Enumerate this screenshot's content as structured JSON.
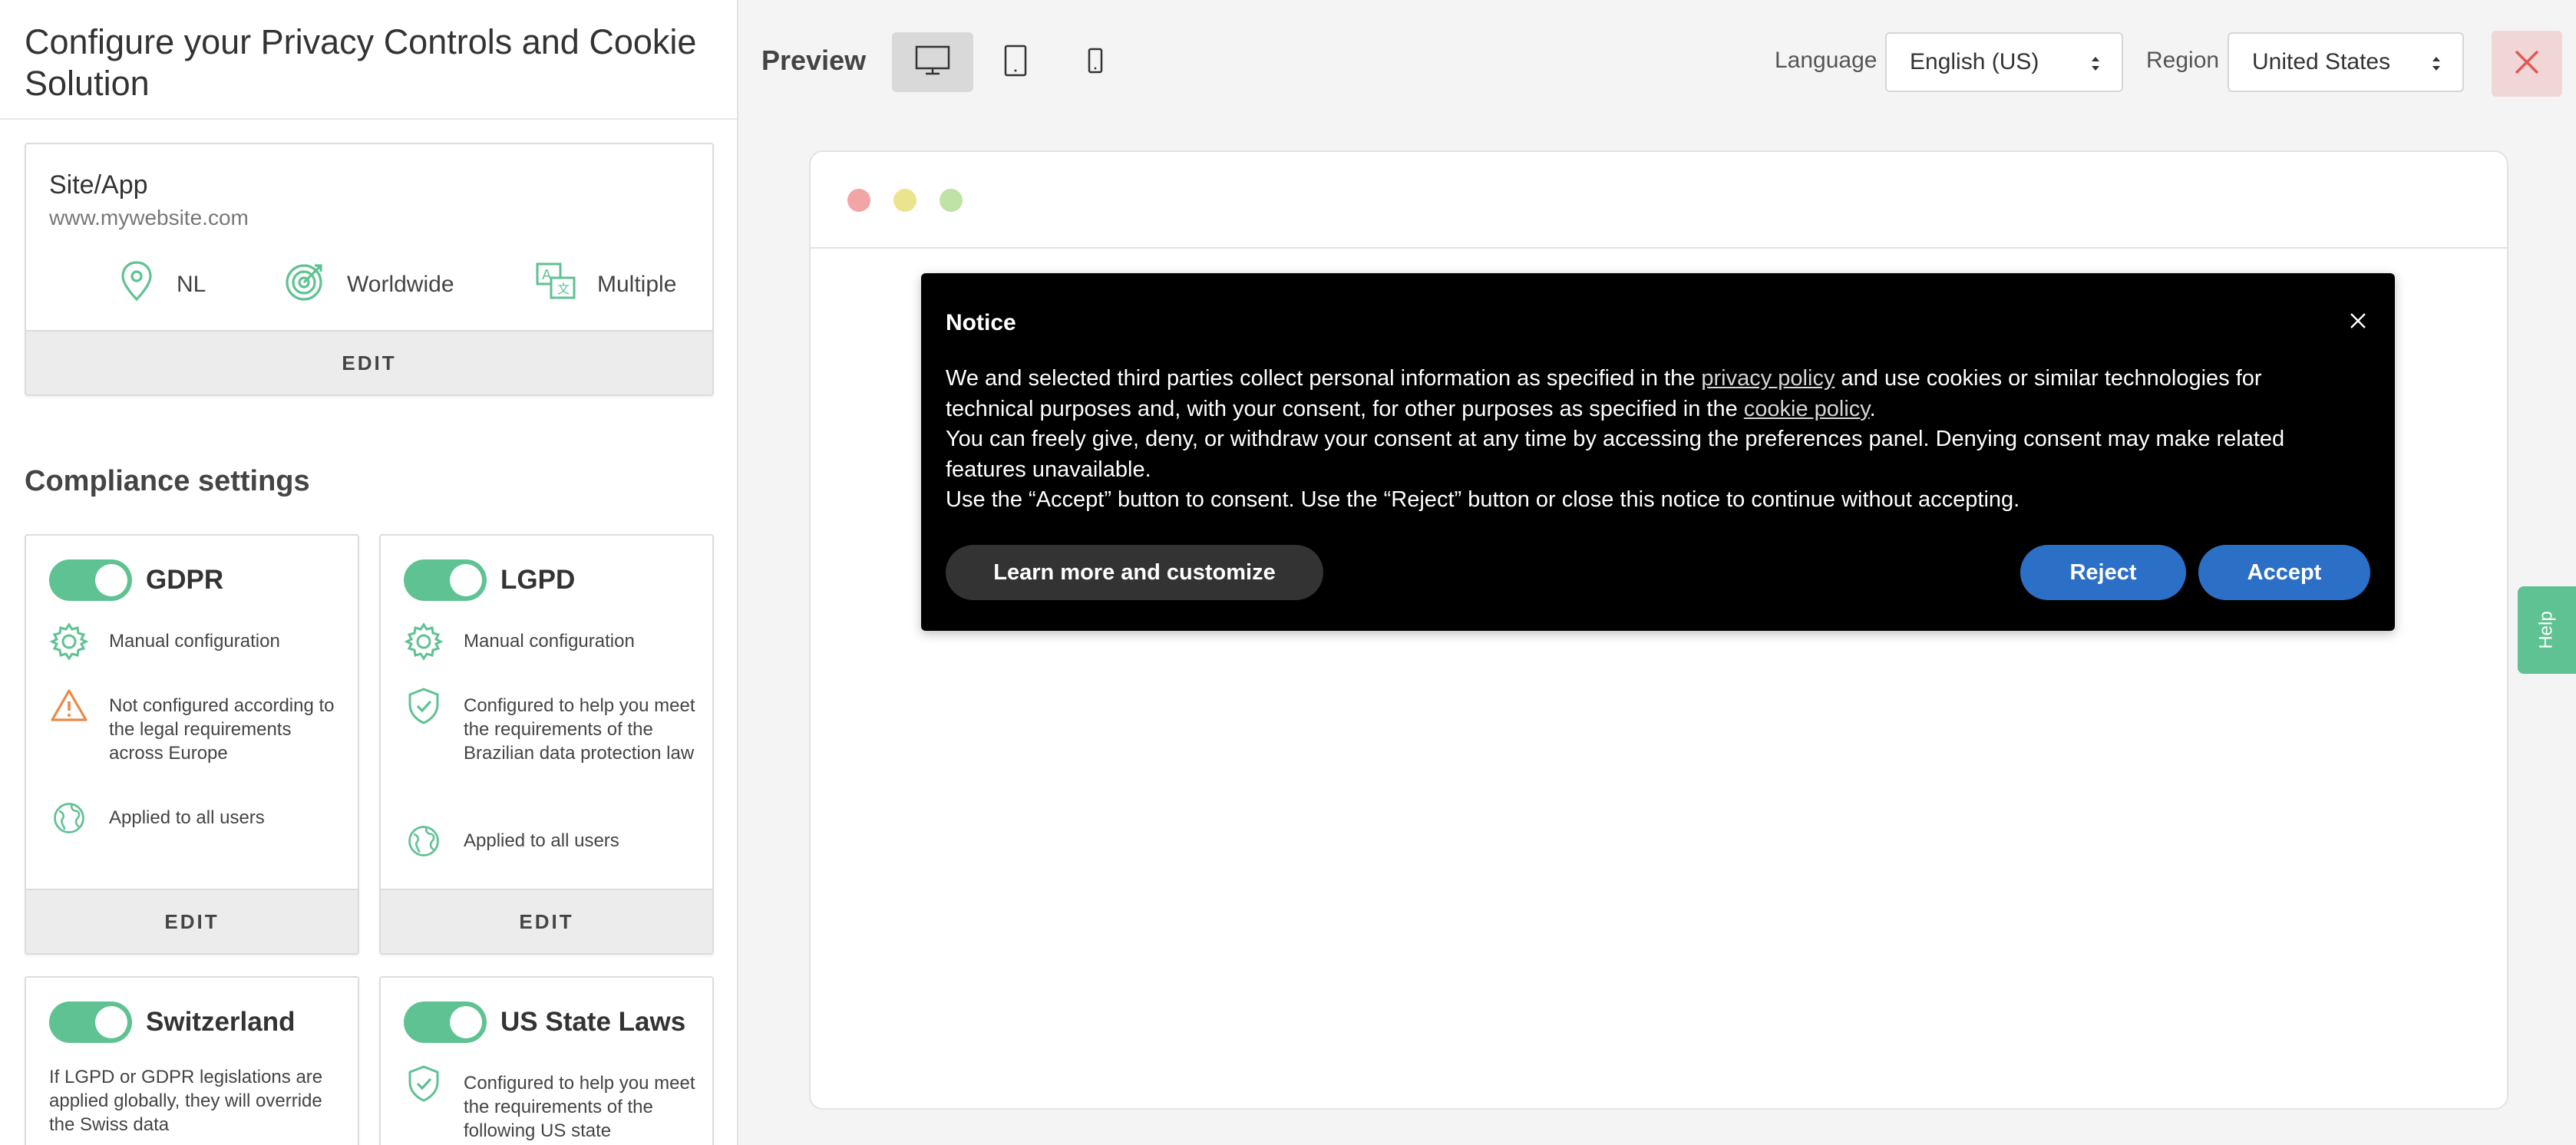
{
  "left_panel": {
    "title": "Configure your Privacy Controls and Cookie Solution",
    "site": {
      "name": "Site/App",
      "url": "www.mywebsite.com",
      "location": "NL",
      "scope": "Worldwide",
      "languages": "Multiple",
      "edit_label": "EDIT"
    },
    "compliance_title": "Compliance settings",
    "regulations": [
      {
        "name": "GDPR",
        "rows": [
          "Manual configuration",
          "Not configured according to the legal requirements across Europe",
          "Applied to all users"
        ],
        "edit_label": "EDIT"
      },
      {
        "name": "LGPD",
        "rows": [
          "Manual configuration",
          "Configured to help you meet the requirements of the Brazilian data protection law",
          "Applied to all users"
        ],
        "edit_label": "EDIT"
      },
      {
        "name": "Switzerland",
        "text": "If LGPD or GDPR legislations are applied globally, they will override the Swiss data"
      },
      {
        "name": "US State Laws",
        "rows": [
          "Configured to help you meet the requirements of the following US state"
        ]
      }
    ]
  },
  "topbar": {
    "preview_label": "Preview",
    "devices": [
      "desktop-icon",
      "tablet-icon",
      "mobile-icon"
    ],
    "language_label": "Language",
    "language_value": "English (US)",
    "region_label": "Region",
    "region_value": "United States"
  },
  "notice": {
    "title": "Notice",
    "line1_a": "We and selected third parties collect personal information as specified in the ",
    "privacy_link": "privacy policy",
    "line1_b": " and use cookies or similar technologies for technical purposes and, with your consent, for other purposes as specified in the ",
    "cookie_link": "cookie policy",
    "line1_c": ".",
    "line2": "You can freely give, deny, or withdraw your consent at any time by accessing the preferences panel. Denying consent may make related features unavailable.",
    "line3": "Use the “Accept” button to consent. Use the “Reject” button or close this notice to continue without accepting.",
    "learn_more": "Learn more and customize",
    "reject": "Reject",
    "accept": "Accept"
  },
  "help_label": "Help",
  "colors": {
    "accent_green": "#5fc292",
    "button_blue": "#2b6fc7",
    "warning_orange": "#e8894a",
    "close_red": "#e05a5a"
  }
}
